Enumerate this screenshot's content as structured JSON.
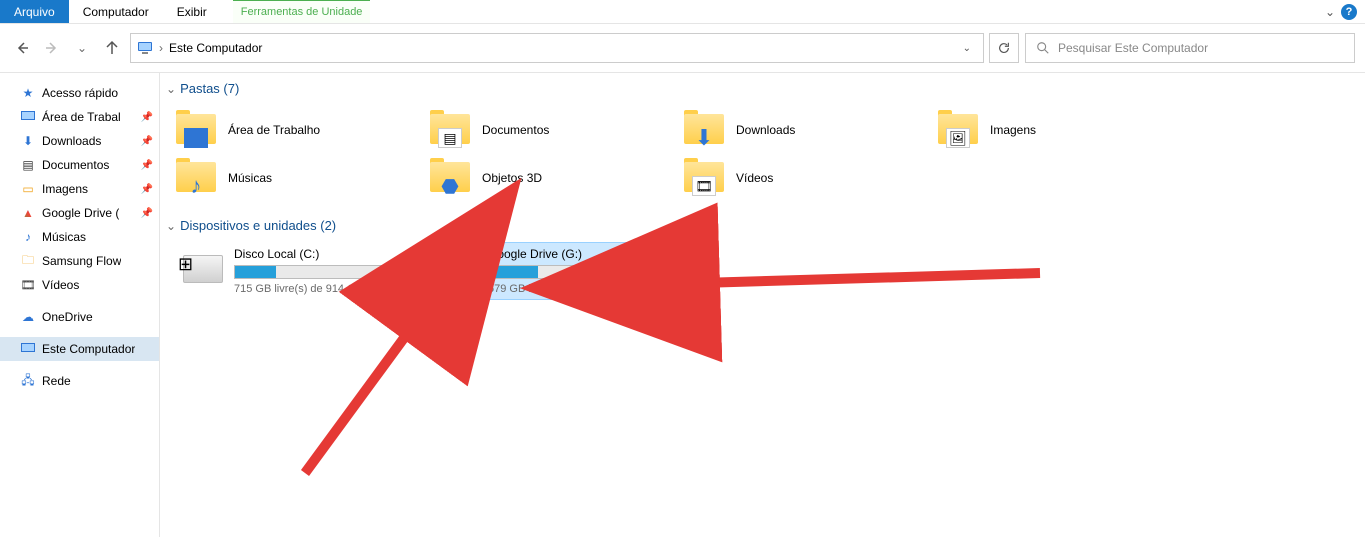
{
  "menu": {
    "file": "Arquivo",
    "computer": "Computador",
    "view": "Exibir",
    "contextual": "Ferramentas de Unidade"
  },
  "address": {
    "crumb": "Este Computador",
    "search_placeholder": "Pesquisar Este Computador"
  },
  "sidebar": {
    "quick_access": "Acesso rápido",
    "items": [
      {
        "label": "Área de Trabal",
        "pinned": true,
        "icon": "desktop"
      },
      {
        "label": "Downloads",
        "pinned": true,
        "icon": "download"
      },
      {
        "label": "Documentos",
        "pinned": true,
        "icon": "document"
      },
      {
        "label": "Imagens",
        "pinned": true,
        "icon": "image"
      },
      {
        "label": "Google Drive (",
        "pinned": true,
        "icon": "gdrive"
      },
      {
        "label": "Músicas",
        "pinned": false,
        "icon": "music"
      },
      {
        "label": "Samsung Flow",
        "pinned": false,
        "icon": "folder"
      },
      {
        "label": "Vídeos",
        "pinned": false,
        "icon": "video"
      }
    ],
    "onedrive": "OneDrive",
    "this_pc": "Este Computador",
    "network": "Rede"
  },
  "sections": {
    "folders_title": "Pastas (7)",
    "drives_title": "Dispositivos e unidades (2)"
  },
  "folders": [
    {
      "label": "Área de Trabalho",
      "overlay": "desktop"
    },
    {
      "label": "Documentos",
      "overlay": "document"
    },
    {
      "label": "Downloads",
      "overlay": "download"
    },
    {
      "label": "Imagens",
      "overlay": "image"
    },
    {
      "label": "Músicas",
      "overlay": "music"
    },
    {
      "label": "Objetos 3D",
      "overlay": "cube"
    },
    {
      "label": "Vídeos",
      "overlay": "video"
    }
  ],
  "drives": [
    {
      "name": "Disco Local (C:)",
      "status": "715 GB livre(s) de 914 GB",
      "fill_percent": 22,
      "selected": false,
      "win_logo": true
    },
    {
      "name": "Google Drive (G:)",
      "status": "679 GB livre(s) de 914 GB",
      "fill_percent": 26,
      "selected": true,
      "win_logo": false
    }
  ]
}
